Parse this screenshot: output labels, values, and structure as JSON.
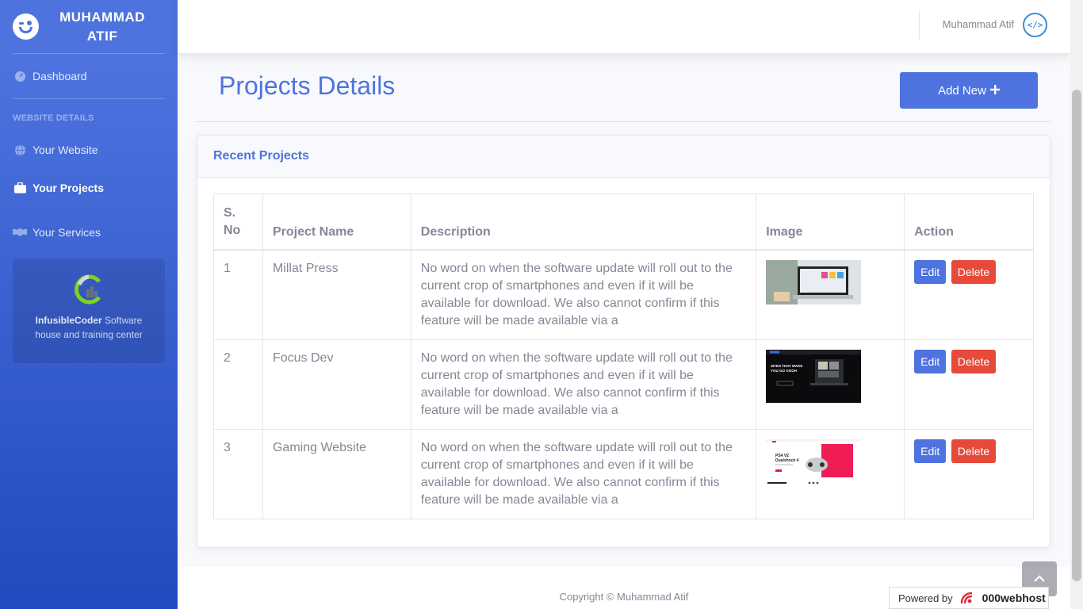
{
  "sidebar": {
    "brand": "MUHAMMAD ATIF",
    "nav": {
      "dashboard": "Dashboard",
      "heading": "Website Details",
      "website": "Your Website",
      "projects": "Your Projects",
      "services": "Your Services"
    },
    "promo": {
      "name": "InfusibleCoder",
      "text": " Software house and training center"
    }
  },
  "topbar": {
    "user_name": "Muhammad Atif",
    "avatar_glyph": "</>"
  },
  "page": {
    "title": "Projects Details",
    "add_button": "Add New"
  },
  "card": {
    "title": "Recent Projects",
    "columns": [
      "S. No",
      "Project Name",
      "Description",
      "Image",
      "Action"
    ],
    "rows": [
      {
        "sno": "1",
        "name": "Millat Press",
        "description": "No word on when the software update will roll out to the current crop of smartphones and even if it will be available for download. We also cannot confirm if this feature will be made available via a",
        "edit": "Edit",
        "delete": "Delete"
      },
      {
        "sno": "2",
        "name": "Focus Dev",
        "description": "No word on when the software update will roll out to the current crop of smartphones and even if it will be available for download. We also cannot confirm if this feature will be made available via a",
        "edit": "Edit",
        "delete": "Delete",
        "thumb_text": [
          "SITES THAT MAKE",
          "YOU GO OOOH"
        ]
      },
      {
        "sno": "3",
        "name": "Gaming Website",
        "description": "No word on when the software update will roll out to the current crop of smartphones and even if it will be available for download. We also cannot confirm if this feature will be made available via a",
        "edit": "Edit",
        "delete": "Delete",
        "thumb_text": [
          "PS4 V2",
          "Dualshock 4"
        ]
      }
    ]
  },
  "footer": {
    "copyright": "Copyright © Muhammad Atif"
  },
  "badge": {
    "powered_by": "Powered by",
    "brand": "000webhost"
  },
  "colors": {
    "primary": "#4e73df",
    "danger": "#e74a3b",
    "text": "#858796"
  }
}
